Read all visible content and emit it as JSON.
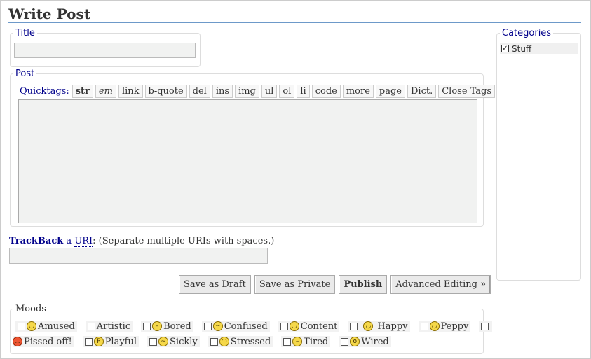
{
  "page": {
    "title": "Write Post"
  },
  "title_section": {
    "legend": "Title",
    "value": ""
  },
  "post_section": {
    "legend": "Post",
    "quicktags_label": "Quicktags",
    "quicktags_colon": ":",
    "buttons": [
      "str",
      "em",
      "link",
      "b-quote",
      "del",
      "ins",
      "img",
      "ul",
      "ol",
      "li",
      "code",
      "more",
      "page",
      "Dict.",
      "Close Tags"
    ],
    "content": ""
  },
  "trackback": {
    "link1": "TrackBack",
    "mid": " a ",
    "link2": "URI",
    "note": ": (Separate multiple URIs with spaces.)",
    "value": ""
  },
  "actions": {
    "save_draft": "Save as Draft",
    "save_private": "Save as Private",
    "publish": "Publish",
    "advanced": "Advanced Editing »"
  },
  "moods": {
    "legend": "Moods",
    "row1": [
      {
        "label": "Amused",
        "icon": "amused-smiley-icon",
        "face": "◡"
      },
      {
        "label": "Artistic",
        "icon": "",
        "face": ""
      },
      {
        "label": "Bored",
        "icon": "bored-smiley-icon",
        "face": "–"
      },
      {
        "label": "Confused",
        "icon": "confused-smiley-icon",
        "face": "~"
      },
      {
        "label": "Content",
        "icon": "content-smiley-icon",
        "face": "◡"
      },
      {
        "label": "Happy",
        "icon": "happy-smiley-icon",
        "face": "◡"
      },
      {
        "label": "Peppy",
        "icon": "peppy-smiley-icon",
        "face": "◡"
      }
    ],
    "row2": [
      {
        "label": "Pissed off!",
        "icon": "pissed-off-smiley-icon",
        "face": "︵"
      },
      {
        "label": "Playful",
        "icon": "playful-smiley-icon",
        "face": "P"
      },
      {
        "label": "Sickly",
        "icon": "sickly-smiley-icon",
        "face": "~"
      },
      {
        "label": "Stressed",
        "icon": "stressed-smiley-icon",
        "face": "◠"
      },
      {
        "label": "Tired",
        "icon": "tired-smiley-icon",
        "face": "–"
      },
      {
        "label": "Wired",
        "icon": "wired-smiley-icon",
        "face": "o"
      }
    ]
  },
  "categories": {
    "legend": "Categories",
    "items": [
      {
        "label": "Stuff",
        "checked": true
      }
    ]
  }
}
